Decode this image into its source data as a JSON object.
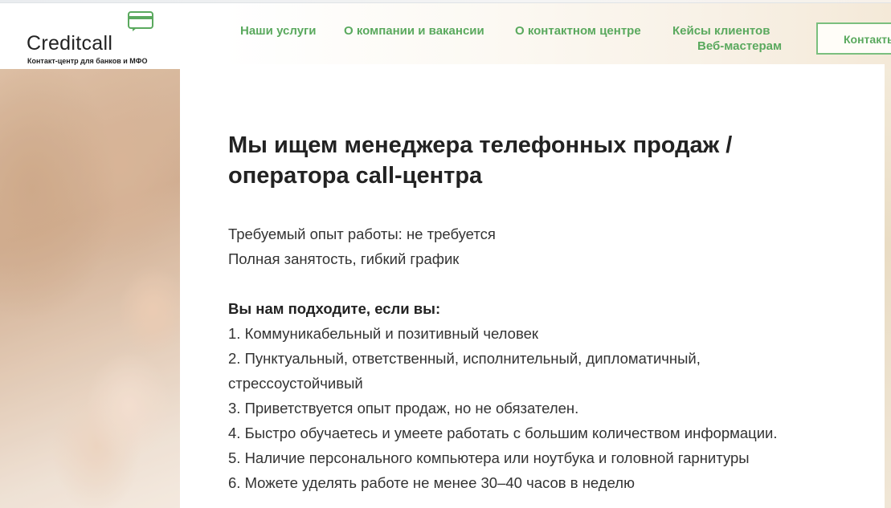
{
  "header": {
    "logo_text": "Creditcall",
    "logo_subtitle": "Контакт-центр для банков и МФО",
    "nav": [
      "Наши услуги",
      "О компании и вакансии",
      "О контактном центре",
      "Кейсы клиентов",
      "Веб-мастерам"
    ],
    "contact_button": "Контакты"
  },
  "colors": {
    "accent": "#5aa95e"
  },
  "vacancy": {
    "title_line1": "Мы ищем менеджера телефонных продаж /",
    "title_line2": "оператора call-центра",
    "experience": "Требуемый опыт работы: не требуется",
    "schedule": "Полная занятость, гибкий график",
    "requirements_heading": "Вы нам подходите, если вы:",
    "requirements": [
      "1. Коммуникабельный и позитивный человек",
      "2. Пунктуальный, ответственный, исполнительный, дипломатичный,",
      "стрессоустойчивый",
      "3. Приветствуется опыт продаж, но не обязателен.",
      "4. Быстро обучаетесь и умеете работать с большим количеством информации.",
      "5. Наличие персонального компьютера или ноутбука и головной гарнитуры",
      "6. Можете уделять работе не менее 30–40 часов в неделю"
    ]
  }
}
